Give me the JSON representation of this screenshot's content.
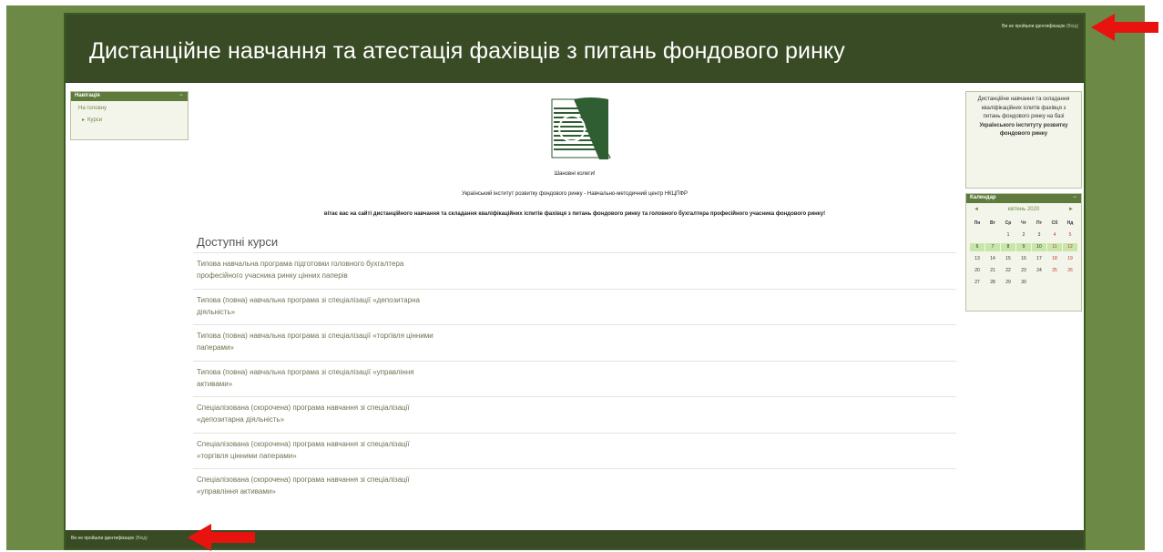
{
  "header": {
    "login_text": "Ви не пройшли ідентифікацію",
    "login_link": "(Вхід)",
    "site_title": "Дистанційне навчання та атестація фахівців з питань фондового ринку"
  },
  "navigation": {
    "title": "Навігація",
    "items": [
      {
        "label": "На головну"
      },
      {
        "label": "Курси"
      }
    ]
  },
  "main": {
    "welcome_line1": "Шановні колеги!",
    "welcome_line2": "Український інститут розвитку фондового ринку - Навчально-методичний центр НКЦПФР",
    "welcome_line3": "вітає вас на сайті дистанційного навчання та складання кваліфікаційних іспитів фахівця з питань фондового ринку та головного бухгалтера професійного учасника фондового ринку!",
    "courses_heading": "Доступні курси",
    "courses": [
      {
        "label": "Типова навчальна програма підготовки головного бухгалтера професійного учасника ринку цінних паперів"
      },
      {
        "label": "Типова (повна) навчальна програма зі спеціалізації «депозитарна діяльність»"
      },
      {
        "label": "Типова (повна) навчальна програма зі спеціалізації «торгівля цінними паперами»"
      },
      {
        "label": "Типова (повна) навчальна програма зі спеціалізації «управління активами»"
      },
      {
        "label": "Спеціалізована (скорочена) програма навчання зі спеціалізації «депозитарна діяльність»"
      },
      {
        "label": "Спеціалізована (скорочена) програма навчання зі спеціалізації «торгівля цінними паперами»"
      },
      {
        "label": "Спеціалізована (скорочена) програма навчання зі спеціалізації «управління активами»"
      }
    ]
  },
  "info": {
    "text_plain": "Дистанційне навчання та складання кваліфікаційних іспитів фахівця з питань фондового ринку на базі",
    "text_bold": "Українського інституту розвитку фондового ринку"
  },
  "calendar": {
    "title": "Календар",
    "month": "квітень 2020",
    "prev": "◄",
    "next": "►",
    "weekdays": [
      "Пн",
      "Вт",
      "Ср",
      "Чт",
      "Пт",
      "Сб",
      "Нд"
    ],
    "days": [
      "",
      "",
      "1",
      "2",
      "3",
      "4",
      "5",
      "6",
      "7",
      "8",
      "9",
      "10",
      "11",
      "12",
      "13",
      "14",
      "15",
      "16",
      "17",
      "18",
      "19",
      "20",
      "21",
      "22",
      "23",
      "24",
      "25",
      "26",
      "27",
      "28",
      "29",
      "30",
      "",
      "",
      ""
    ]
  },
  "footer": {
    "login_text": "Ви не пройшли ідентифікацію",
    "login_link": "(Вхід)"
  },
  "colors": {
    "header_bg": "#394b24",
    "outer_bg": "#6c8a46",
    "arrow": "#e8130f",
    "highlight_day": "#c9e6a9"
  }
}
